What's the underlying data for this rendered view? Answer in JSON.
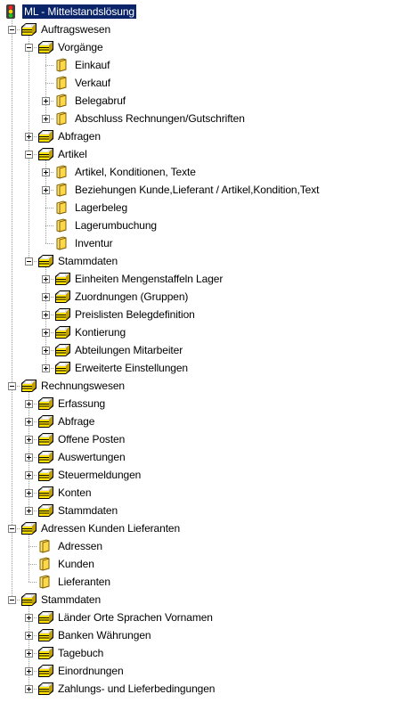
{
  "window": {
    "title": "ML - Mittelstandslösung"
  },
  "tree": [
    {
      "label": "ML - Mittelstandslösung",
      "icon": "traffic-light-icon",
      "selected": true,
      "children": [
        {
          "label": "Auftragswesen",
          "icon": "cabinet-icon",
          "expanded": true,
          "children": [
            {
              "label": "Vorgänge",
              "icon": "cabinet-icon",
              "expanded": true,
              "children": [
                {
                  "label": "Einkauf",
                  "icon": "folder-icon"
                },
                {
                  "label": "Verkauf",
                  "icon": "folder-icon"
                },
                {
                  "label": "Belegabruf",
                  "icon": "folder-icon",
                  "collapsed": true
                },
                {
                  "label": "Abschluss Rechnungen/Gutschriften",
                  "icon": "folder-icon",
                  "collapsed": true
                }
              ]
            },
            {
              "label": "Abfragen",
              "icon": "cabinet-icon",
              "collapsed": true
            },
            {
              "label": "Artikel",
              "icon": "cabinet-icon",
              "expanded": true,
              "children": [
                {
                  "label": "Artikel, Konditionen, Texte",
                  "icon": "folder-icon",
                  "collapsed": true
                },
                {
                  "label": "Beziehungen Kunde,Lieferant / Artikel,Kondition,Text",
                  "icon": "folder-icon",
                  "collapsed": true
                },
                {
                  "label": "Lagerbeleg",
                  "icon": "folder-icon"
                },
                {
                  "label": "Lagerumbuchung",
                  "icon": "folder-icon"
                },
                {
                  "label": "Inventur",
                  "icon": "folder-icon"
                }
              ]
            },
            {
              "label": "Stammdaten",
              "icon": "cabinet-icon",
              "expanded": true,
              "children": [
                {
                  "label": "Einheiten Mengenstaffeln Lager",
                  "icon": "cabinet-icon",
                  "collapsed": true
                },
                {
                  "label": "Zuordnungen (Gruppen)",
                  "icon": "cabinet-icon",
                  "collapsed": true
                },
                {
                  "label": "Preislisten Belegdefinition",
                  "icon": "cabinet-icon",
                  "collapsed": true
                },
                {
                  "label": "Kontierung",
                  "icon": "cabinet-icon",
                  "collapsed": true
                },
                {
                  "label": "Abteilungen Mitarbeiter",
                  "icon": "cabinet-icon",
                  "collapsed": true
                },
                {
                  "label": "Erweiterte Einstellungen",
                  "icon": "cabinet-icon",
                  "collapsed": true
                }
              ]
            }
          ]
        },
        {
          "label": "Rechnungswesen",
          "icon": "cabinet-icon",
          "expanded": true,
          "children": [
            {
              "label": "Erfassung",
              "icon": "cabinet-icon",
              "collapsed": true
            },
            {
              "label": "Abfrage",
              "icon": "cabinet-icon",
              "collapsed": true
            },
            {
              "label": "Offene Posten",
              "icon": "cabinet-icon",
              "collapsed": true
            },
            {
              "label": "Auswertungen",
              "icon": "cabinet-icon",
              "collapsed": true
            },
            {
              "label": "Steuermeldungen",
              "icon": "cabinet-icon",
              "collapsed": true
            },
            {
              "label": "Konten",
              "icon": "cabinet-icon",
              "collapsed": true
            },
            {
              "label": "Stammdaten",
              "icon": "cabinet-icon",
              "collapsed": true
            }
          ]
        },
        {
          "label": "Adressen Kunden Lieferanten",
          "icon": "cabinet-icon",
          "expanded": true,
          "children": [
            {
              "label": "Adressen",
              "icon": "folder-icon"
            },
            {
              "label": "Kunden",
              "icon": "folder-icon"
            },
            {
              "label": "Lieferanten",
              "icon": "folder-icon"
            }
          ]
        },
        {
          "label": "Stammdaten",
          "icon": "cabinet-icon",
          "expanded": true,
          "children": [
            {
              "label": "Länder Orte Sprachen Vornamen",
              "icon": "cabinet-icon",
              "collapsed": true
            },
            {
              "label": "Banken Währungen",
              "icon": "cabinet-icon",
              "collapsed": true
            },
            {
              "label": "Tagebuch",
              "icon": "cabinet-icon",
              "collapsed": true
            },
            {
              "label": "Einordnungen",
              "icon": "cabinet-icon",
              "collapsed": true
            },
            {
              "label": "Zahlungs- und Lieferbedingungen",
              "icon": "cabinet-icon",
              "collapsed": true
            }
          ]
        }
      ]
    }
  ]
}
